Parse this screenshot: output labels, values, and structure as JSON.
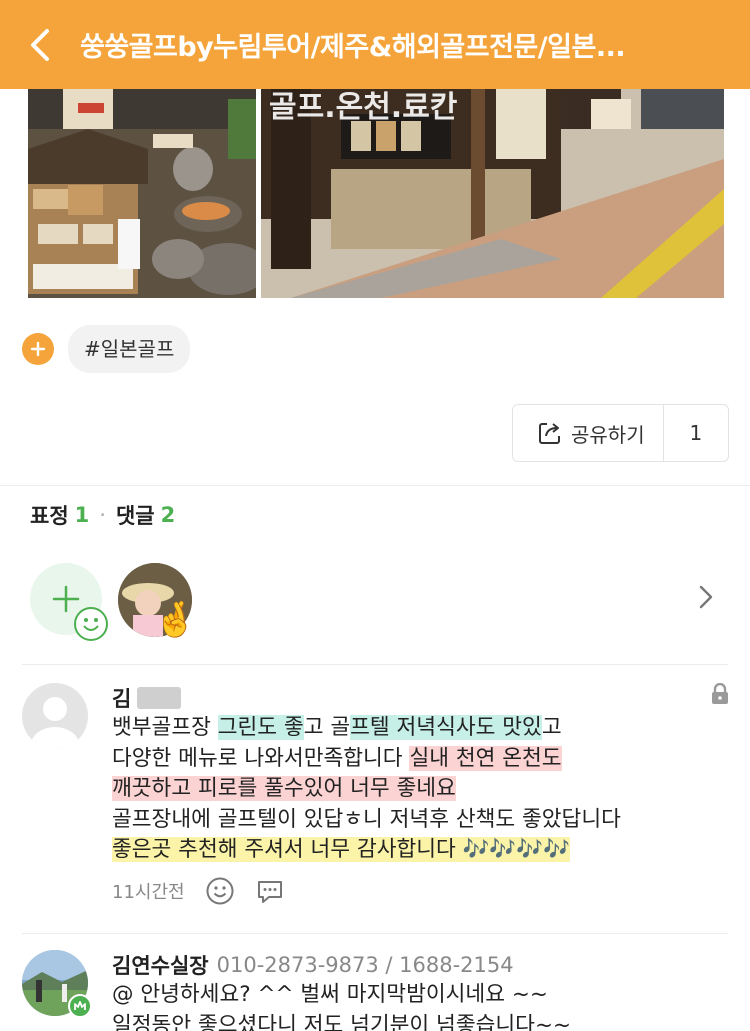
{
  "header": {
    "title": "쑹쑹골프by누림투어/제주&해외골프전문/일본...",
    "back_icon": "chevron-left-icon",
    "bg_color": "#F4A43A"
  },
  "photos": {
    "right_overlay_text": "골프.온천.료칸"
  },
  "tags": {
    "add_icon": "plus-icon",
    "items": [
      "#일본골프"
    ]
  },
  "share": {
    "label": "공유하기",
    "count": "1"
  },
  "stats": {
    "reactions_label": "표정",
    "reactions_count": "1",
    "separator": "·",
    "comments_label": "댓글",
    "comments_count": "2"
  },
  "comments": [
    {
      "author": "김",
      "lines": [
        [
          {
            "t": "뱃부골프장 "
          },
          {
            "t": "그린도 좋",
            "hl": "cyan"
          },
          {
            "t": "고 골"
          },
          {
            "t": "프텔 저녁식사도 맛있",
            "hl": "cyan"
          },
          {
            "t": "고"
          }
        ],
        [
          {
            "t": "다양한 메뉴로 나와서만족합니다 "
          },
          {
            "t": "실내 천연 온천도",
            "hl": "pink"
          }
        ],
        [
          {
            "t": "깨끗하고 피로를 풀수있어 너무 좋네요",
            "hl": "pink"
          }
        ],
        [
          {
            "t": "골프장내에 골프텔이 있답ㅎ니 저녁후 산책도 좋았답니다"
          }
        ],
        [
          {
            "t": "좋은곳 추천해 주셔서 너무 감사합니다 🎶🎶🎶🎶",
            "hl": "yellow"
          }
        ]
      ],
      "time": "11시간전"
    },
    {
      "author": "김연수실장",
      "phones": "010-2873-9873 / 1688-2154",
      "line1": "@      안녕하세요? ^^    벌써 마지막밤이시네요 ~~",
      "line2": "일정동안 좋으셨다니    저도 넘기분이 넘좋습니다~~"
    }
  ]
}
